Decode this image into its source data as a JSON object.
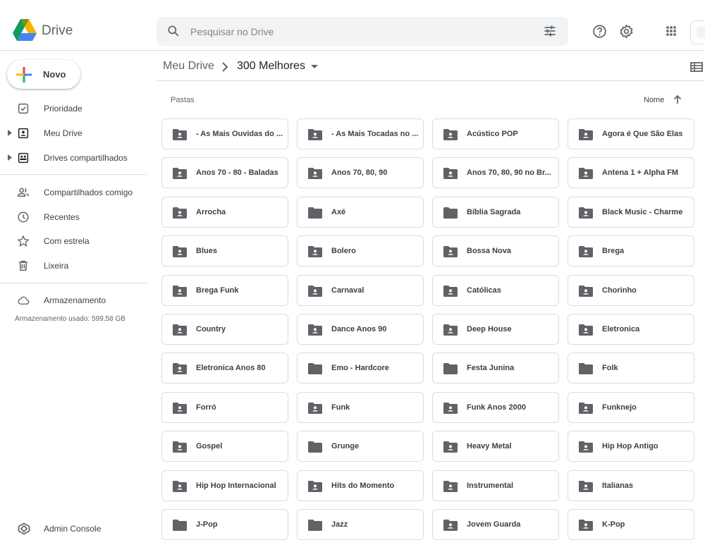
{
  "header": {
    "app_name": "Drive",
    "search_placeholder": "Pesquisar no Drive"
  },
  "sidebar": {
    "new_label": "Novo",
    "items": [
      {
        "label": "Prioridade",
        "icon": "priority-icon"
      },
      {
        "label": "Meu Drive",
        "icon": "my-drive-icon"
      },
      {
        "label": "Drives compartilhados",
        "icon": "shared-drives-icon"
      },
      {
        "label": "Compartilhados comigo",
        "icon": "people-icon"
      },
      {
        "label": "Recentes",
        "icon": "clock-icon"
      },
      {
        "label": "Com estrela",
        "icon": "star-icon"
      },
      {
        "label": "Lixeira",
        "icon": "trash-icon"
      }
    ],
    "storage_label": "Armazenamento",
    "storage_used": "Armazenamento usado: 599,58 GB",
    "admin_label": "Admin Console"
  },
  "breadcrumb": {
    "root": "Meu Drive",
    "current": "300 Melhores"
  },
  "main": {
    "section_label": "Pastas",
    "sort_label": "Nome"
  },
  "folders": [
    {
      "name": "- As Mais Ouvidas do ...",
      "shared": true
    },
    {
      "name": "- As Mais Tocadas no ...",
      "shared": true
    },
    {
      "name": "Acústico POP",
      "shared": true
    },
    {
      "name": "Agora é Que São Elas",
      "shared": true
    },
    {
      "name": "Anos 70 - 80 - Baladas",
      "shared": true
    },
    {
      "name": "Anos 70, 80, 90",
      "shared": true
    },
    {
      "name": "Anos 70, 80, 90 no Br...",
      "shared": true
    },
    {
      "name": "Antena 1 + Alpha FM",
      "shared": true
    },
    {
      "name": "Arrocha",
      "shared": true
    },
    {
      "name": "Axé",
      "shared": false
    },
    {
      "name": "Bíblia Sagrada",
      "shared": false
    },
    {
      "name": "Black Music - Charme",
      "shared": true
    },
    {
      "name": "Blues",
      "shared": true
    },
    {
      "name": "Bolero",
      "shared": true
    },
    {
      "name": "Bossa Nova",
      "shared": true
    },
    {
      "name": "Brega",
      "shared": true
    },
    {
      "name": "Brega Funk",
      "shared": true
    },
    {
      "name": "Carnaval",
      "shared": true
    },
    {
      "name": "Católicas",
      "shared": true
    },
    {
      "name": "Chorinho",
      "shared": true
    },
    {
      "name": "Country",
      "shared": true
    },
    {
      "name": "Dance Anos 90",
      "shared": true
    },
    {
      "name": "Deep House",
      "shared": true
    },
    {
      "name": "Eletronica",
      "shared": true
    },
    {
      "name": "Eletronica Anos 80",
      "shared": true
    },
    {
      "name": "Emo - Hardcore",
      "shared": false
    },
    {
      "name": "Festa Junina",
      "shared": false
    },
    {
      "name": "Folk",
      "shared": false
    },
    {
      "name": "Forró",
      "shared": true
    },
    {
      "name": "Funk",
      "shared": true
    },
    {
      "name": "Funk Anos 2000",
      "shared": true
    },
    {
      "name": "Funknejo",
      "shared": true
    },
    {
      "name": "Gospel",
      "shared": true
    },
    {
      "name": "Grunge",
      "shared": false
    },
    {
      "name": "Heavy Metal",
      "shared": true
    },
    {
      "name": "Hip Hop Antigo",
      "shared": true
    },
    {
      "name": "Hip Hop Internacional",
      "shared": true
    },
    {
      "name": "Hits do Momento",
      "shared": true
    },
    {
      "name": "Instrumental",
      "shared": true
    },
    {
      "name": "Italianas",
      "shared": true
    },
    {
      "name": "J-Pop",
      "shared": false
    },
    {
      "name": "Jazz",
      "shared": false
    },
    {
      "name": "Jovem Guarda",
      "shared": true
    },
    {
      "name": "K-Pop",
      "shared": true
    }
  ],
  "colors": {
    "icon": "#5f6368",
    "border": "#dadce0",
    "search_bg": "#f1f3f4",
    "logo_green": "#0f9d58",
    "logo_yellow": "#f4b400",
    "logo_blue": "#4285f4"
  }
}
